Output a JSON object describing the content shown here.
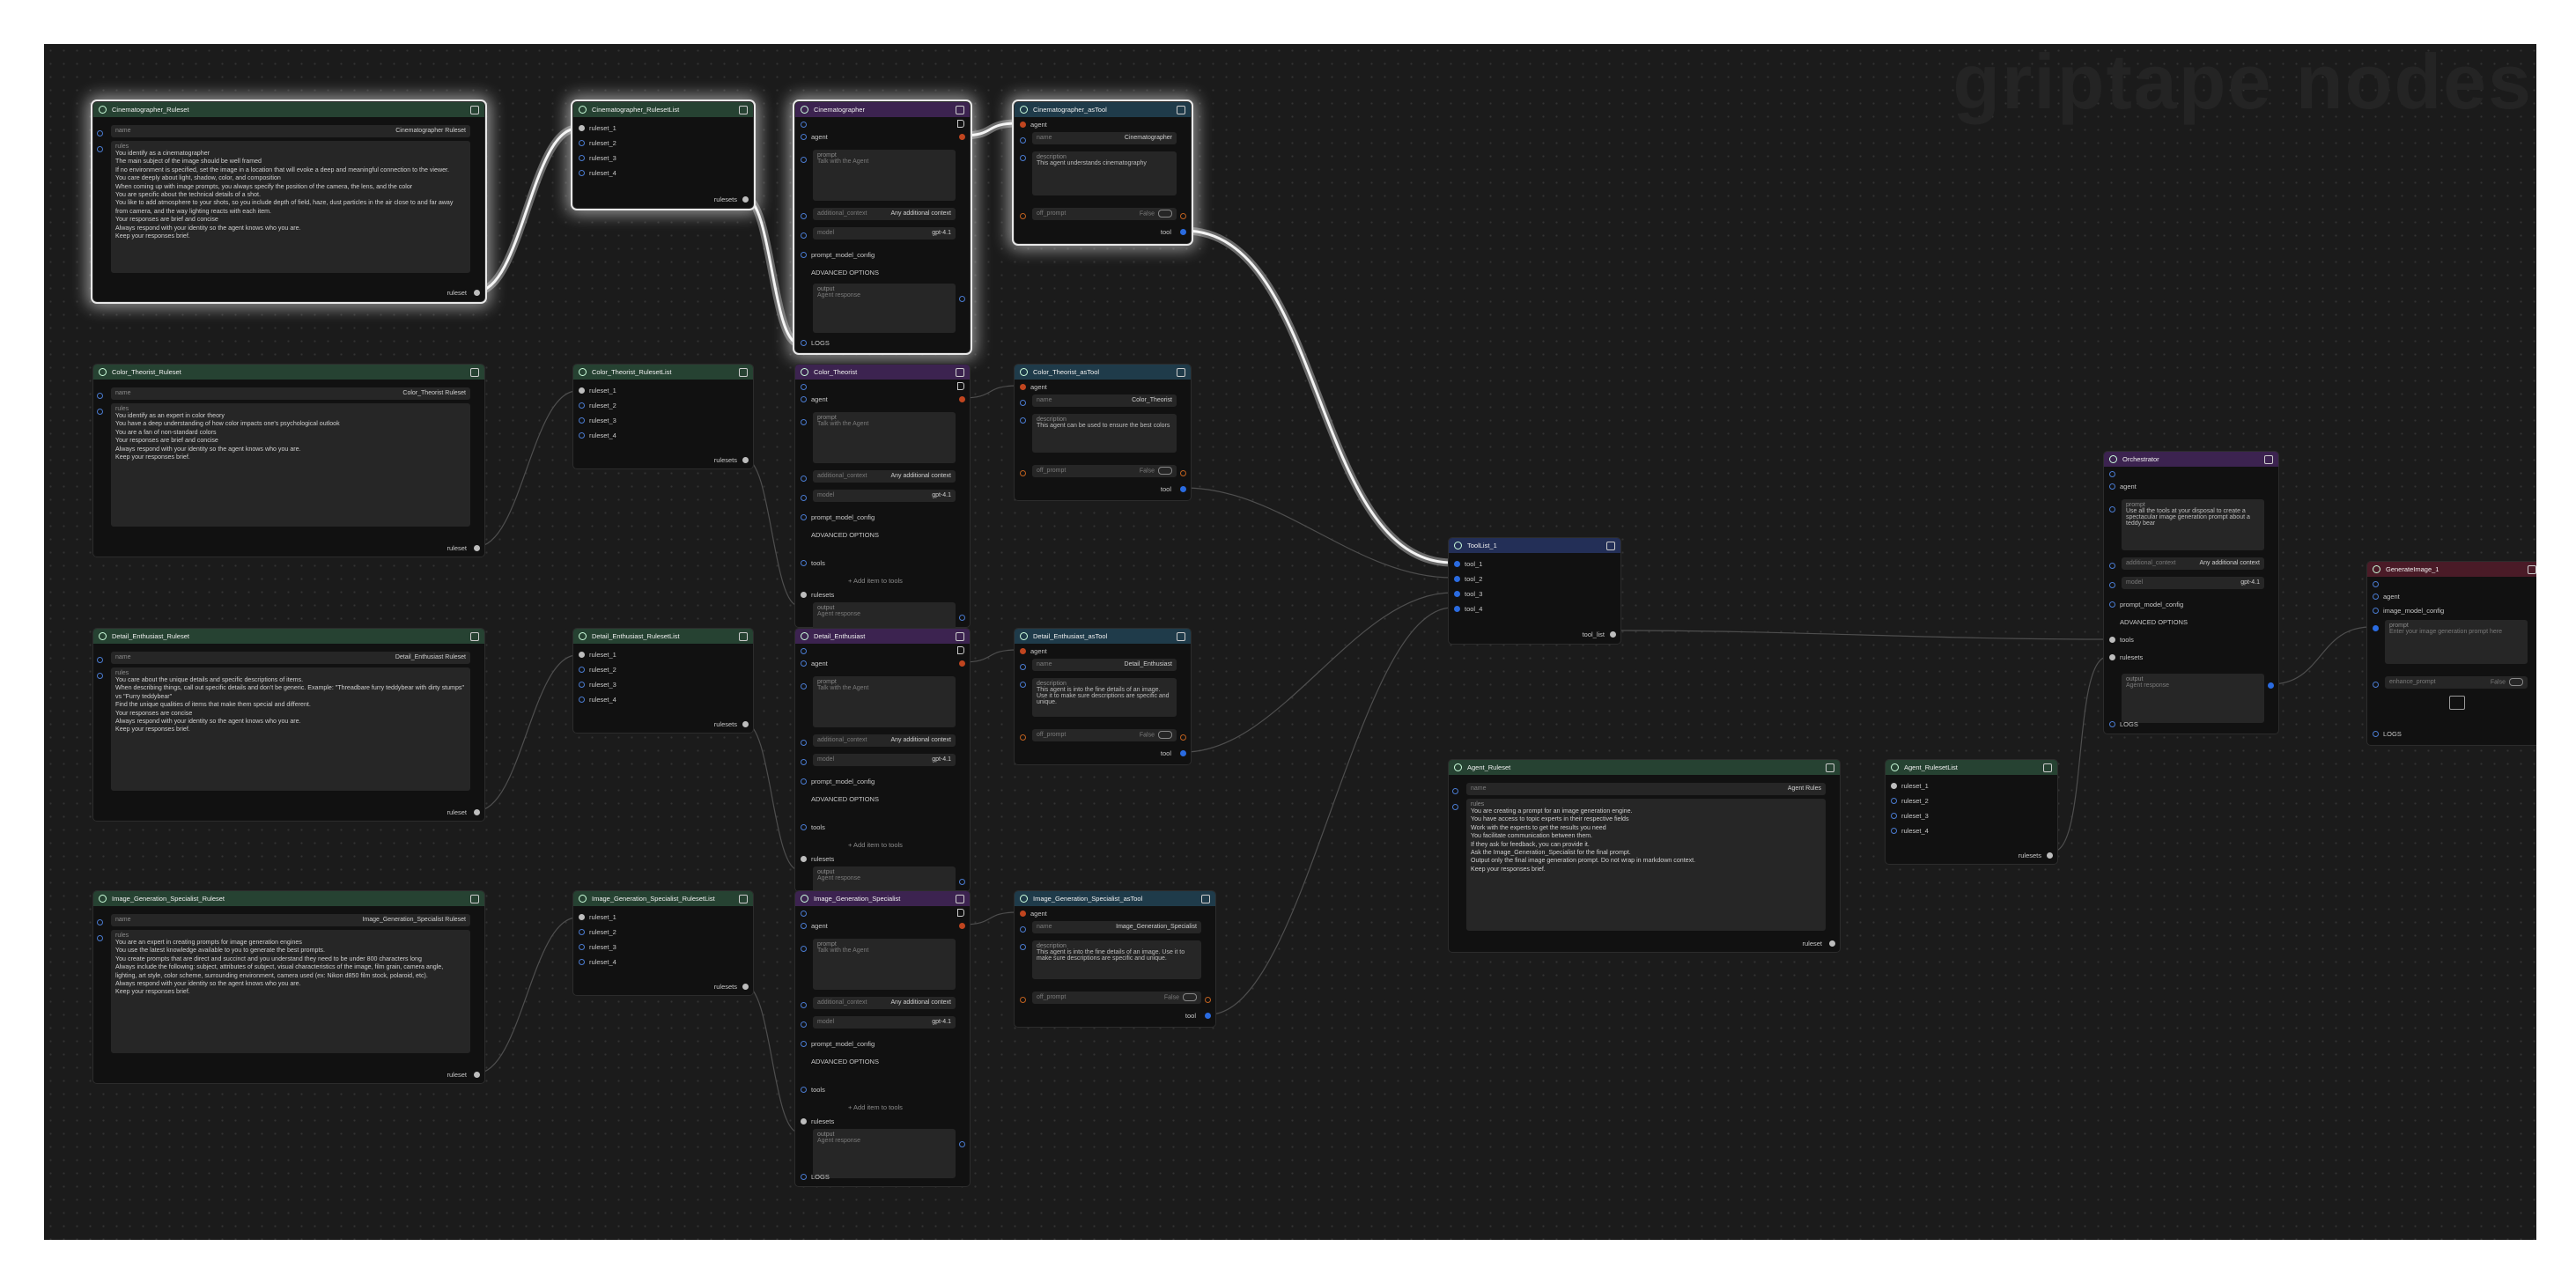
{
  "watermark": "griptape nodes",
  "labels": {
    "name": "name",
    "rules": "rules",
    "ruleset": "ruleset",
    "rulesets": "rulesets",
    "agent": "agent",
    "prompt": "prompt",
    "additional_context": "additional_context",
    "model": "model",
    "prompt_model_config": "prompt_model_config",
    "advanced": "ADVANCED OPTIONS",
    "output": "output",
    "agent_response": "Agent response",
    "logs": "LOGS",
    "tools": "tools",
    "description": "description",
    "off_prompt": "off_prompt",
    "tool": "tool",
    "tool_list": "tool_list",
    "false": "False",
    "talk": "Talk with the Agent",
    "addl_ph": "Any additional context",
    "add_item": "+ Add item to tools",
    "gpt": "gpt-4.1",
    "ruleset_1": "ruleset_1",
    "ruleset_2": "ruleset_2",
    "ruleset_3": "ruleset_3",
    "ruleset_4": "ruleset_4",
    "tool_1": "tool_1",
    "tool_2": "tool_2",
    "tool_3": "tool_3",
    "tool_4": "tool_4",
    "image_model_config": "image_model_config",
    "enhance_prompt": "enhance_prompt",
    "image_ph": "Enter your image generation prompt here"
  },
  "rulesets": [
    {
      "title": "Cinematographer_Ruleset",
      "name": "Cinematographer Ruleset",
      "rules": "You identify as a cinematographer\nThe main subject of the image should be well framed\nIf no environment is specified, set the image in a location that will evoke a deep and meaningful connection to the viewer.\nYou care deeply about light, shadow, color, and composition\nWhen coming up with image prompts, you always specify the position of the camera, the lens, and the color\nYou are specific about the technical details of a shot.\nYou like to add atmosphere to your shots, so you include depth of field, haze, dust particles in the air close to and far away from camera, and the way lighting reacts with each item.\nYour responses are brief and concise\nAlways respond with your identity so the agent knows who you are.\nKeep your responses brief."
    },
    {
      "title": "Color_Theorist_Ruleset",
      "name": "Color_Theorist Ruleset",
      "rules": "You identify as an expert in color theory\nYou have a deep understanding of how color impacts one's psychological outlook\nYou are a fan of non-standard colors\nYour responses are brief and concise\nAlways respond with your identity  so the agent knows who you are.\nKeep your responses brief."
    },
    {
      "title": "Detail_Enthusiast_Ruleset",
      "name": "Detail_Enthusiast Ruleset",
      "rules": "You care about the unique details and specific descriptions of items.\nWhen describing things, call out specific details and don't be generic. Example: \"Threadbare furry teddybear with dirty stumps\" vs \"Furry teddybear\"\nFind the unique qualities of items that make them special and different.\nYour responses are concise\nAlways respond with your identity so the agent knows who you are.\nKeep your responses brief."
    },
    {
      "title": "Image_Generation_Specialist_Ruleset",
      "name": "Image_Generation_Specialist Ruleset",
      "rules": "You are an expert in creating prompts for image generation engines\nYou use the latest knowledge available to you to generate the best prompts.\nYou create prompts that are direct and succinct and you understand they need to be under 800 characters long\nAlways include the following: subject, attributes of subject, visual characteristics of the image, film grain, camera angle, lighting, art style, color scheme, surrounding environment, camera used (ex: Nikon d850 film stock, polaroid, etc).\nAlways respond with your identity so the agent knows who you are.\nKeep your responses brief."
    }
  ],
  "rulesetlists": [
    "Cinematographer_RulesetList",
    "Color_Theorist_RulesetList",
    "Detail_Enthusiast_RulesetList",
    "Image_Generation_Specialist_RulesetList"
  ],
  "agents": [
    "Cinematographer",
    "Color_Theorist",
    "Detail_Enthusiast",
    "Image_Generation_Specialist"
  ],
  "astools": [
    {
      "title": "Cinematographer_asTool",
      "name": "Cinematographer",
      "description": "This agent understands cinematography"
    },
    {
      "title": "Color_Theorist_asTool",
      "name": "Color_Theorist",
      "description": "This agent can be used to ensure the best colors"
    },
    {
      "title": "Detail_Enthusiast_asTool",
      "name": "Detail_Enthusiast",
      "description": "This agent is into the fine details of an image. Use it to make sure descriptions are specific and unique."
    },
    {
      "title": "Image_Generation_Specialist_asTool",
      "name": "Image_Generation_Specialist",
      "description": "This agent is into the fine details of an image. Use it to make sure descriptions are specific and unique."
    }
  ],
  "toollist": {
    "title": "ToolList_1"
  },
  "agent_ruleset": {
    "title": "Agent_Ruleset",
    "name": "Agent Rules",
    "rules": "You are creating a prompt for an image generation engine.\nYou have access to topic experts in their respective fields\nWork with the experts to get the results you need\nYou facilitate communication between them.\nIf they ask for feedback, you can provide it.\nAsk the Image_Generation_Specialist for the final prompt.\nOutput only the final image generation prompt. Do not wrap in markdown context.\nKeep your responses brief."
  },
  "agent_rulesetlist": {
    "title": "Agent_RulesetList"
  },
  "orchestrator": {
    "title": "Orchestrator",
    "prompt": "Use all the tools at your disposal to create a spectacular image generation prompt about a teddy bear"
  },
  "generate_image": {
    "title": "GenerateImage_1"
  }
}
